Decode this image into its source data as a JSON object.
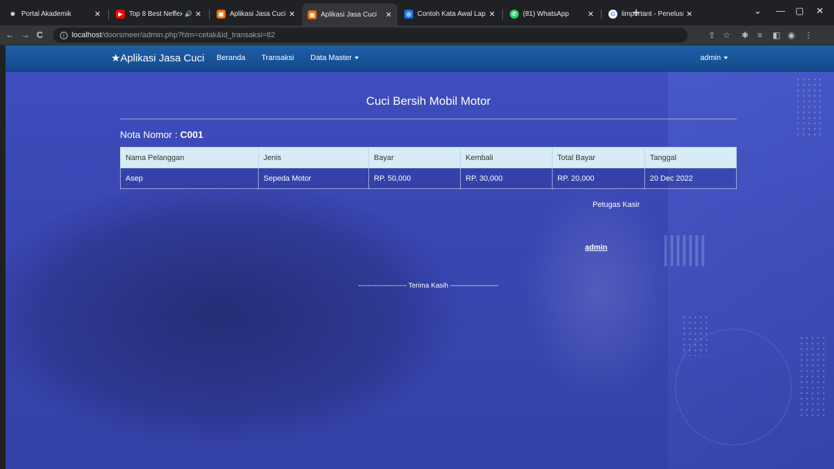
{
  "browser": {
    "tabs": [
      {
        "title": "Portal Akademik",
        "favicon_color": "#202124",
        "favicon_glyph": "☸",
        "active": false,
        "closable": true
      },
      {
        "title": "Top 8 Best Neffex",
        "favicon_color": "#ff0000",
        "favicon_glyph": "▶",
        "active": false,
        "closable": true,
        "audio": "🔊"
      },
      {
        "title": "Aplikasi Jasa Cuci",
        "favicon_color": "#e8710a",
        "favicon_glyph": "▣",
        "active": false,
        "closable": true
      },
      {
        "title": "Aplikasi Jasa Cuci",
        "favicon_color": "#e8710a",
        "favicon_glyph": "▣",
        "active": true,
        "closable": true
      },
      {
        "title": "Contoh Kata Awal Lap",
        "favicon_color": "#1a73e8",
        "favicon_glyph": "◎",
        "active": false,
        "closable": true
      },
      {
        "title": "(81) WhatsApp",
        "favicon_color": "#25d366",
        "favicon_glyph": "✆",
        "active": false,
        "closable": true
      },
      {
        "title": "limportant - Penelusu",
        "favicon_color": "#ffffff",
        "favicon_glyph": "G",
        "active": false,
        "closable": true
      }
    ],
    "url_host": "localhost",
    "url_path": "/doorsmeer/admin.php?hlm=cetak&id_transaksi=82"
  },
  "navbar": {
    "brand": "★Aplikasi Jasa Cuci",
    "links": [
      "Beranda",
      "Transaksi",
      "Data Master"
    ],
    "user": "admin"
  },
  "receipt": {
    "title": "Cuci Bersih Mobil Motor",
    "nota_label": "Nota Nomor : ",
    "nota_number": "C001",
    "columns": [
      "Nama Pelanggan",
      "Jenis",
      "Bayar",
      "Kembali",
      "Total Bayar",
      "Tanggal"
    ],
    "rows": [
      [
        "Asep",
        "Sepeda Motor",
        "RP. 50,000",
        "RP. 30,000",
        "RP. 20,000",
        "20 Dec 2022"
      ]
    ],
    "cashier_label": "Petugas Kasir",
    "cashier_name": "admin",
    "thanks": "--------------------- Terima Kasih ---------------------"
  },
  "colors": {
    "navbar": "#1a56a0",
    "page_bg": "#3a47b4",
    "table_header": "#d7ecf5"
  }
}
